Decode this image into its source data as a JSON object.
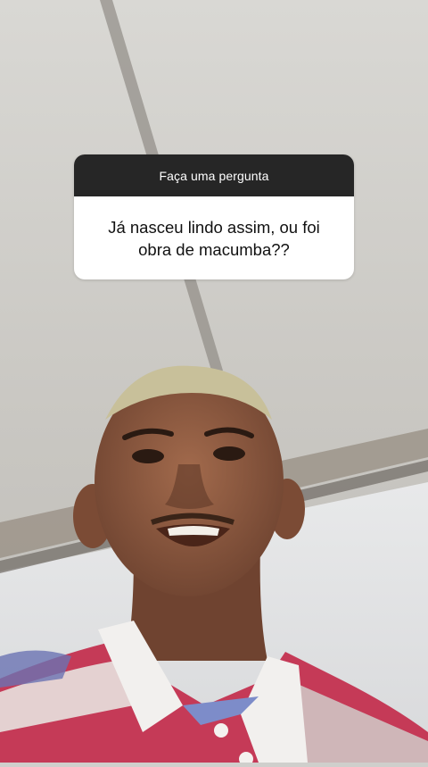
{
  "question_sticker": {
    "header_label": "Faça uma pergunta",
    "question_text": "Já nasceu lindo assim, ou foi obra de macumba??"
  },
  "colors": {
    "header_bg": "#262626",
    "card_bg": "#ffffff",
    "text_dark": "#111111"
  }
}
